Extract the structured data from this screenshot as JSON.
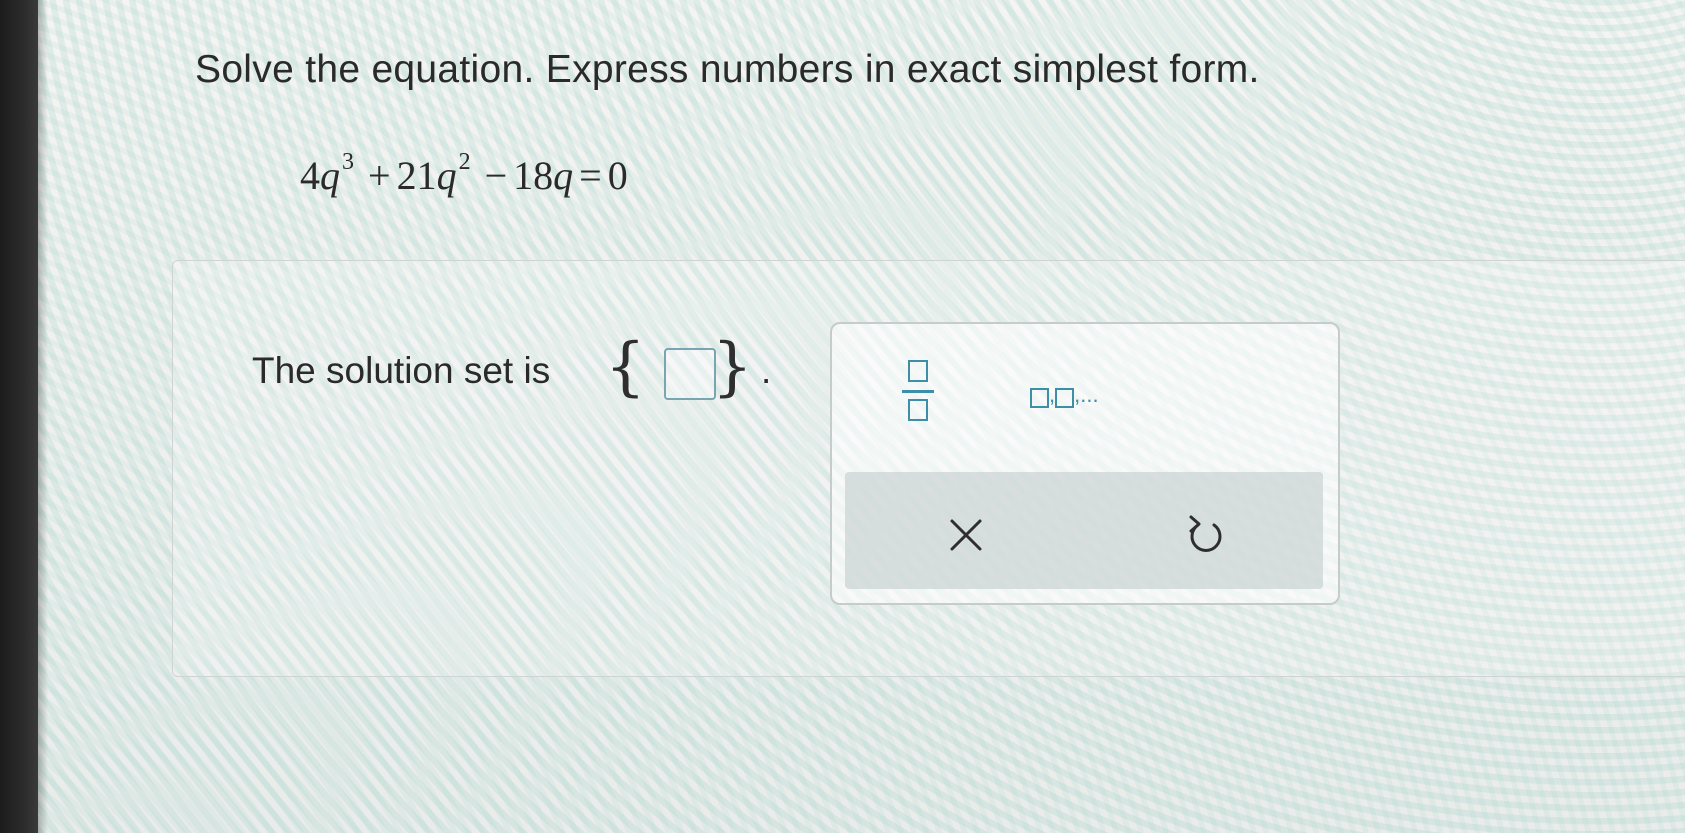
{
  "question": {
    "instruction": "Solve the equation. Express numbers in exact simplest form."
  },
  "equation": {
    "term1_coef": "4",
    "var": "q",
    "exp1": "3",
    "op1": "+",
    "term2_coef": "21",
    "exp2": "2",
    "op2": "−",
    "term3_coef": "18",
    "equals": "=",
    "rhs": "0"
  },
  "answer": {
    "label": "The solution set is",
    "open_brace": "{",
    "close_brace": "}",
    "period": ".",
    "value": ""
  },
  "palette": {
    "list_tool_suffix": ",...",
    "list_tool_sep": ","
  },
  "icons": {
    "fraction": "fraction-icon",
    "list": "list-icon",
    "clear": "x-icon",
    "undo": "undo-icon"
  },
  "colors": {
    "accent": "#3f8ea8",
    "text": "#2a2a2a"
  }
}
